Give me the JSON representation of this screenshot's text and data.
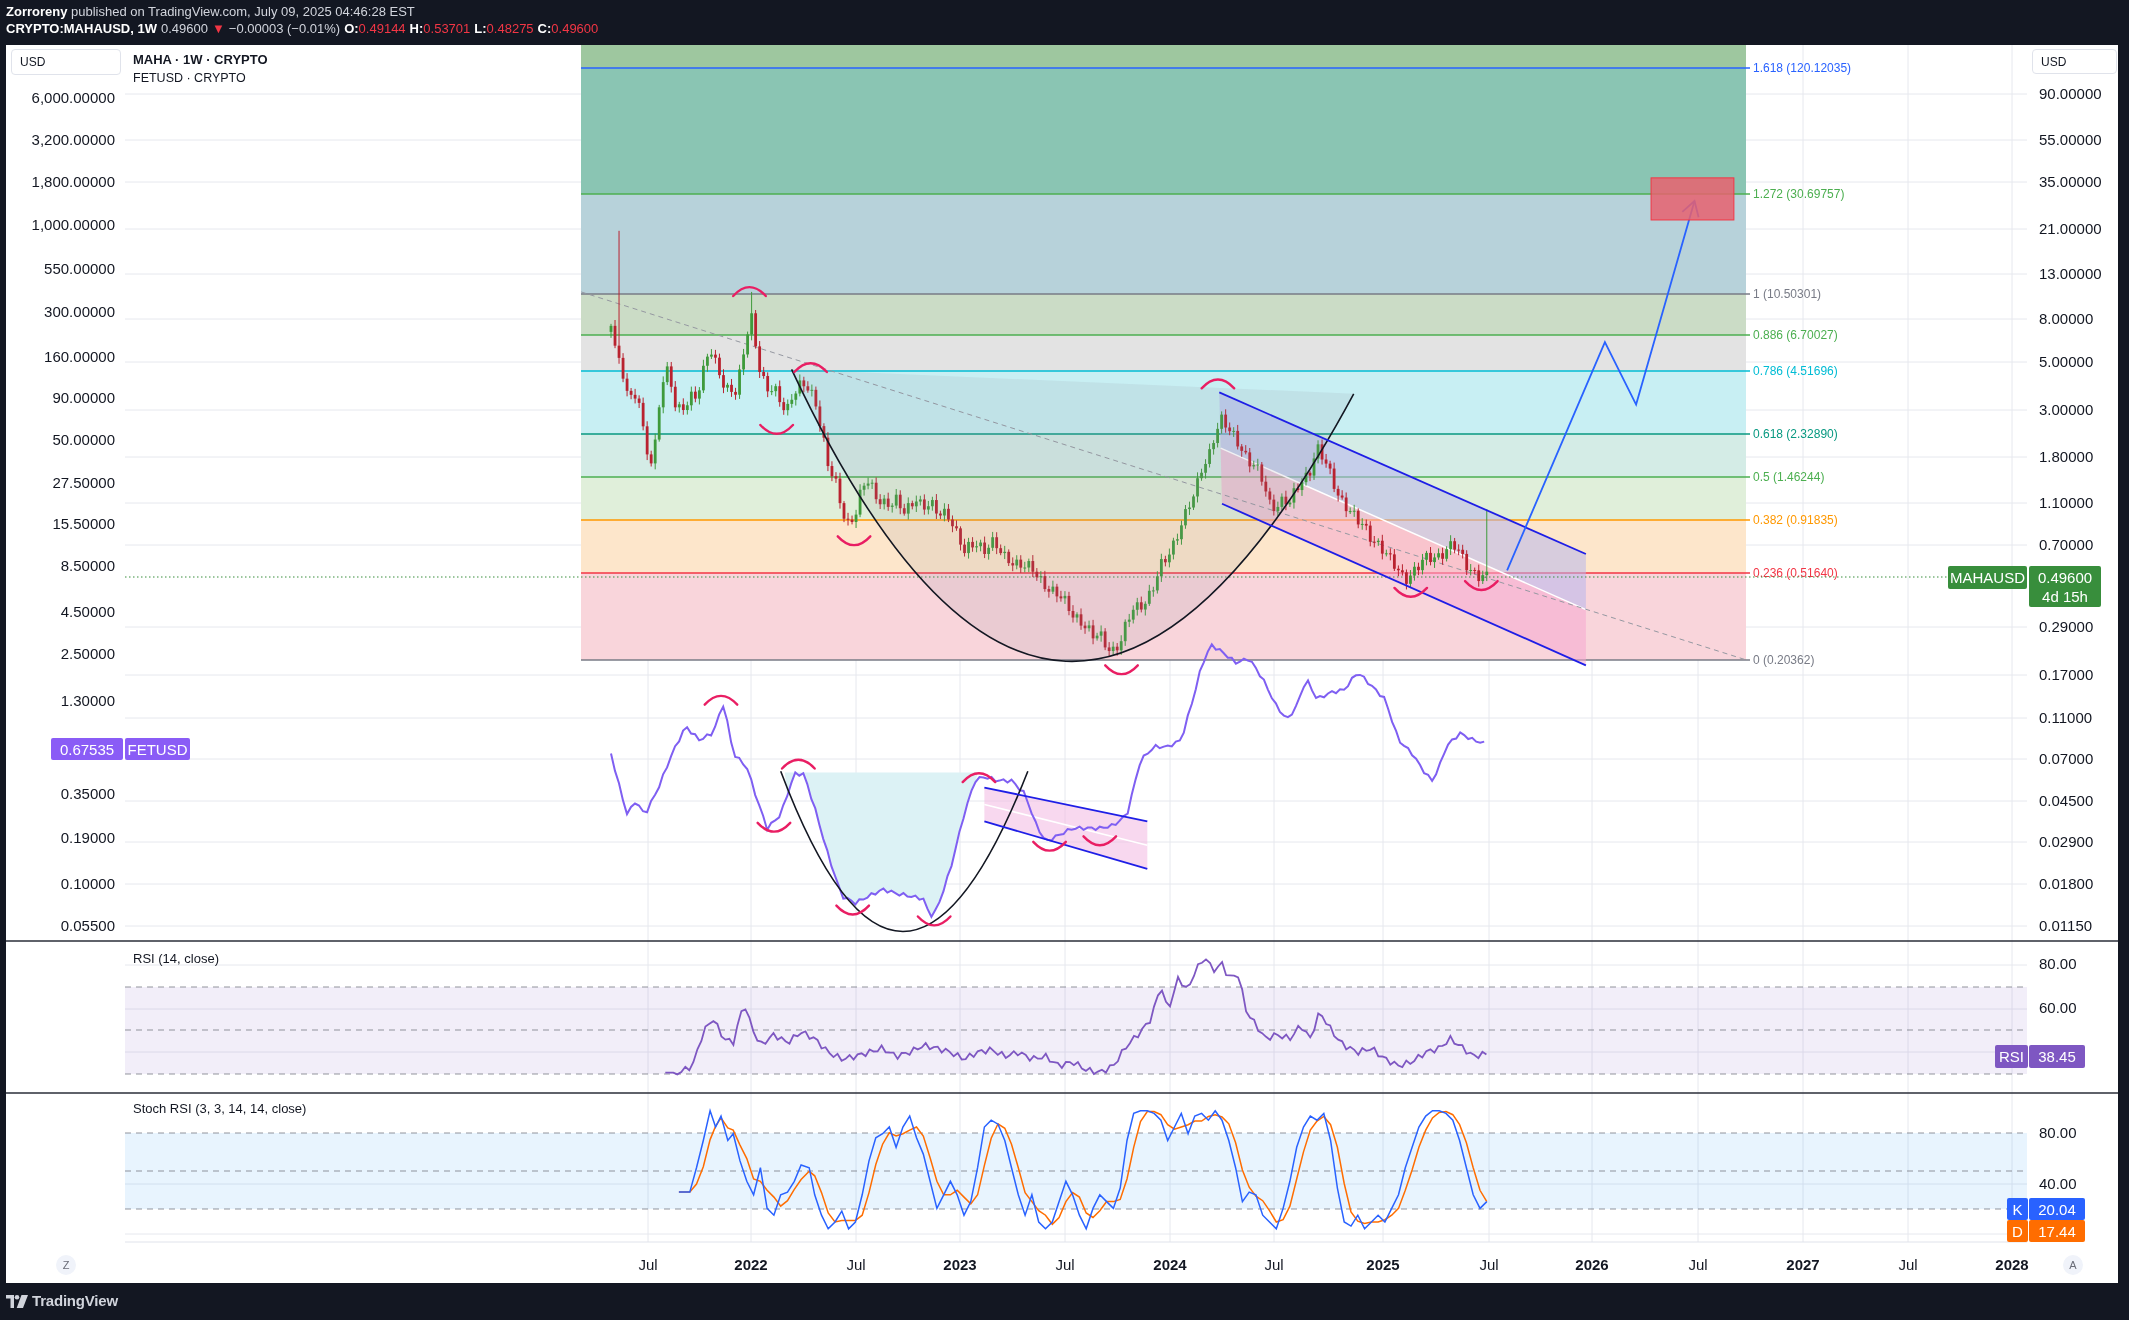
{
  "header": {
    "publish_note": "**Zorroreny** published on TradingView.com, July 09, 2025 04:46:28 EST",
    "symbol": "CRYPTO:MAHAUSD, 1W",
    "last_price": "0.49600",
    "change_arrow": "▼",
    "change": "−0.00003 (−0.01%)",
    "ohlc": [
      {
        "label": "O:",
        "value": "0.49144"
      },
      {
        "label": "H:",
        "value": "0.53701"
      },
      {
        "label": "L:",
        "value": "0.48275"
      },
      {
        "label": "C:",
        "value": "0.49600"
      }
    ]
  },
  "main_pane": {
    "legend": {
      "title": "MAHA · 1W · CRYPTO",
      "subtitle": "FETUSD · CRYPTO"
    },
    "left_axis": {
      "unit": "USD",
      "labels": [
        "6,000.00000",
        "3,200.00000",
        "1,800.00000",
        "1,000.00000",
        "550.00000",
        "300.00000",
        "160.00000",
        "90.00000",
        "50.00000",
        "27.50000",
        "15.50000",
        "8.50000",
        "4.50000",
        "2.50000",
        "1.30000",
        "0.35000",
        "0.19000",
        "0.10000",
        "0.05500"
      ],
      "badge": {
        "value": "0.67535",
        "symbol": "FETUSD"
      }
    },
    "right_axis": {
      "unit": "USD",
      "labels": [
        "90.00000",
        "55.00000",
        "35.00000",
        "21.00000",
        "13.00000",
        "8.00000",
        "5.00000",
        "3.00000",
        "1.80000",
        "1.10000",
        "0.70000",
        "0.29000",
        "0.17000",
        "0.11000",
        "0.07000",
        "0.04500",
        "0.02900",
        "0.01800",
        "0.01150"
      ],
      "badge": {
        "symbol": "MAHAUSD",
        "value": "0.49600",
        "countdown": "4d 15h"
      }
    },
    "fib_levels": [
      {
        "label": "1.618 (120.12035)",
        "color": "#2962ff"
      },
      {
        "label": "1.272 (30.69757)",
        "color": "#4caf50"
      },
      {
        "label": "1 (10.50301)",
        "color": "#787b86"
      },
      {
        "label": "0.886 (6.70027)",
        "color": "#4caf50"
      },
      {
        "label": "0.786 (4.51696)",
        "color": "#00bcd4"
      },
      {
        "label": "0.618 (2.32890)",
        "color": "#089981"
      },
      {
        "label": "0.5 (1.46244)",
        "color": "#4caf50"
      },
      {
        "label": "0.382 (0.91835)",
        "color": "#ff9800"
      },
      {
        "label": "0.236 (0.51640)",
        "color": "#f23645"
      },
      {
        "label": "0 (0.20362)",
        "color": "#787b86"
      }
    ]
  },
  "rsi_pane": {
    "title": "RSI (14, close)",
    "axis_labels": [
      "80.00",
      "60.00"
    ],
    "badge": {
      "label": "RSI",
      "value": "38.45"
    }
  },
  "stoch_pane": {
    "title": "Stoch RSI (3, 3, 14, 14, close)",
    "axis_labels": [
      "80.00",
      "40.00"
    ],
    "badges": [
      {
        "label": "K",
        "value": "20.04",
        "color": "#2962ff"
      },
      {
        "label": "D",
        "value": "17.44",
        "color": "#ff6d00"
      }
    ]
  },
  "time_axis": {
    "left_button": "Z",
    "labels": [
      {
        "text": "Jul",
        "kind": "month"
      },
      {
        "text": "2022",
        "kind": "year"
      },
      {
        "text": "Jul",
        "kind": "month"
      },
      {
        "text": "2023",
        "kind": "year"
      },
      {
        "text": "Jul",
        "kind": "month"
      },
      {
        "text": "2024",
        "kind": "year"
      },
      {
        "text": "Jul",
        "kind": "month"
      },
      {
        "text": "2025",
        "kind": "year"
      },
      {
        "text": "Jul",
        "kind": "month"
      },
      {
        "text": "2026",
        "kind": "year"
      },
      {
        "text": "Jul",
        "kind": "month"
      },
      {
        "text": "2027",
        "kind": "year"
      },
      {
        "text": "Jul",
        "kind": "month"
      },
      {
        "text": "2028",
        "kind": "year"
      }
    ],
    "right_button": "A"
  },
  "footer": {
    "brand": "TradingView"
  }
}
